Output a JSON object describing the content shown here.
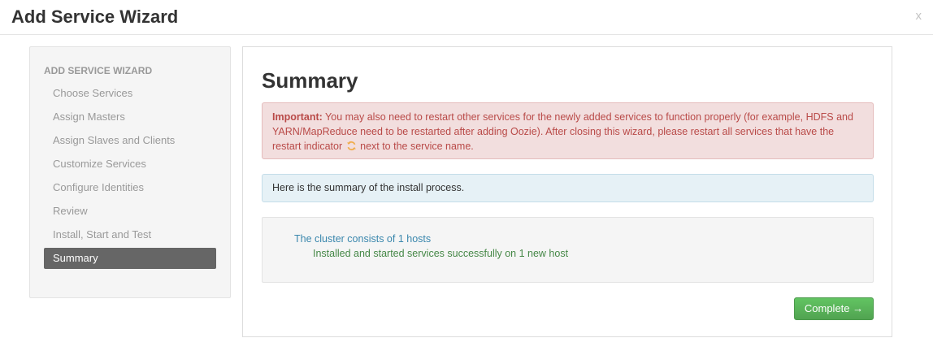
{
  "dialog": {
    "title": "Add Service Wizard",
    "close_label": "x"
  },
  "sidebar": {
    "header": "ADD SERVICE WIZARD",
    "items": [
      {
        "label": "Choose Services",
        "active": false
      },
      {
        "label": "Assign Masters",
        "active": false
      },
      {
        "label": "Assign Slaves and Clients",
        "active": false
      },
      {
        "label": "Customize Services",
        "active": false
      },
      {
        "label": "Configure Identities",
        "active": false
      },
      {
        "label": "Review",
        "active": false
      },
      {
        "label": "Install, Start and Test",
        "active": false
      },
      {
        "label": "Summary",
        "active": true
      }
    ]
  },
  "main": {
    "title": "Summary",
    "alert_error": {
      "strong": "Important:",
      "text_before_icon": " You may also need to restart other services for the newly added services to function properly (for example, HDFS and YARN/MapReduce need to be restarted after adding Oozie). After closing this wizard, please restart all services that have the restart indicator",
      "icon": "refresh-icon",
      "text_after_icon": " next to the service name."
    },
    "alert_info": "Here is the summary of the install process.",
    "summary": {
      "line1": "The cluster consists of 1 hosts",
      "line2": "Installed and started services successfully on 1 new host"
    },
    "complete_button": "Complete →"
  },
  "colors": {
    "active_nav_bg": "#666666",
    "error_text": "#b94a48",
    "error_bg": "#f2dede",
    "info_bg": "#e6f1f6",
    "info_link": "#3a87ad",
    "success_text": "#468847",
    "button_green": "#51a351",
    "refresh_icon": "#f0ad4e"
  }
}
